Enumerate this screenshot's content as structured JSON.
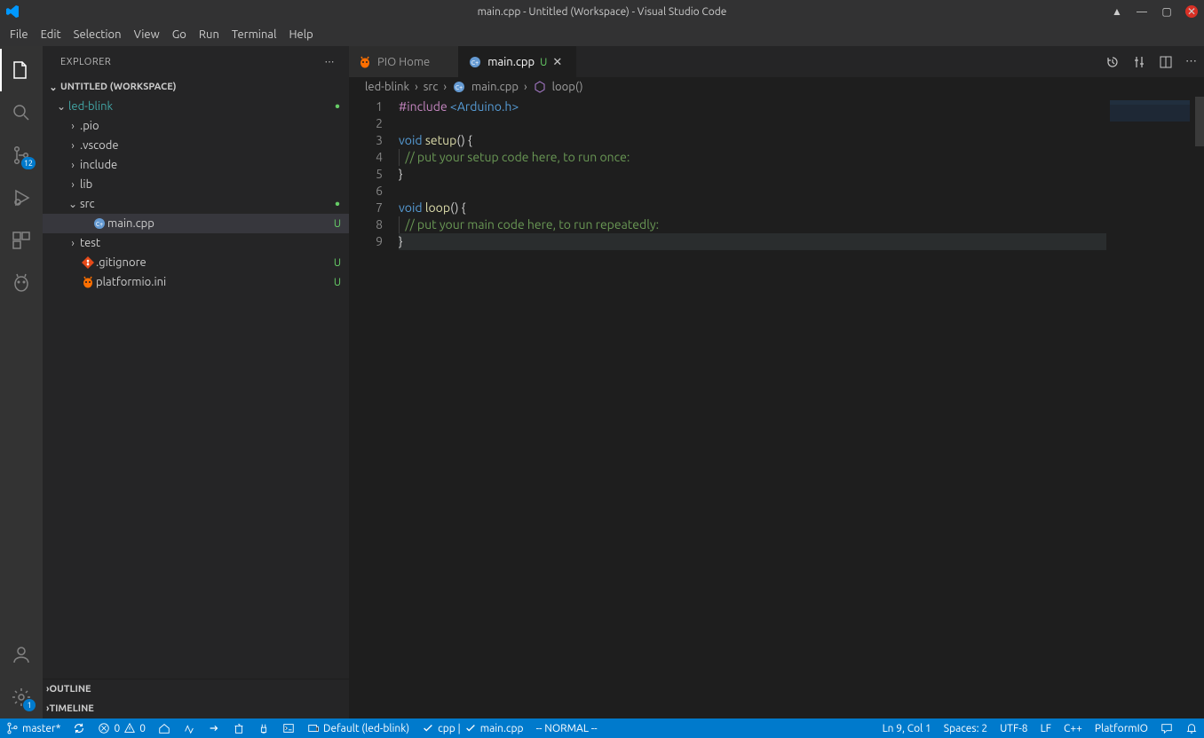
{
  "title": "main.cpp - Untitled (Workspace) - Visual Studio Code",
  "menu": [
    "File",
    "Edit",
    "Selection",
    "View",
    "Go",
    "Run",
    "Terminal",
    "Help"
  ],
  "activity": {
    "scm_badge": "12",
    "settings_badge": "1"
  },
  "sidebar": {
    "header": "EXPLORER",
    "workspace": "UNTITLED (WORKSPACE)",
    "tree": [
      {
        "indent": 0,
        "open": true,
        "type": "folder",
        "name": "led-blink",
        "dot": true,
        "cls": "fldr-led"
      },
      {
        "indent": 1,
        "open": false,
        "type": "folder",
        "name": ".pio"
      },
      {
        "indent": 1,
        "open": false,
        "type": "folder",
        "name": ".vscode"
      },
      {
        "indent": 1,
        "open": false,
        "type": "folder",
        "name": "include"
      },
      {
        "indent": 1,
        "open": false,
        "type": "folder",
        "name": "lib"
      },
      {
        "indent": 1,
        "open": true,
        "type": "folder",
        "name": "src",
        "dot": true
      },
      {
        "indent": 2,
        "type": "file",
        "icon": "cpp",
        "name": "main.cpp",
        "status": "U",
        "active": true
      },
      {
        "indent": 1,
        "open": false,
        "type": "folder",
        "name": "test"
      },
      {
        "indent": 1,
        "type": "file",
        "icon": "git",
        "name": ".gitignore",
        "status": "U"
      },
      {
        "indent": 1,
        "type": "file",
        "icon": "pio",
        "name": "platformio.ini",
        "status": "U"
      }
    ],
    "outline": "OUTLINE",
    "timeline": "TIMELINE"
  },
  "tabs": [
    {
      "icon": "pio",
      "label": "PIO Home",
      "active": false
    },
    {
      "icon": "cpp",
      "label": "main.cpp",
      "status": "U",
      "active": true
    }
  ],
  "breadcrumb": [
    "led-blink",
    "src",
    "main.cpp",
    "loop()"
  ],
  "code": {
    "lines": [
      {
        "n": 1,
        "html": "<span class='tok-pp'>#include</span> <span class='tok-inc'>&lt;Arduino.h&gt;</span>"
      },
      {
        "n": 2,
        "html": ""
      },
      {
        "n": 3,
        "html": "<span class='tok-kw'>void</span> <span class='tok-fn'>setup</span><span class='tok-pn'>() {</span>"
      },
      {
        "n": 4,
        "html": "<span class='guide'></span>  <span class='tok-cm'>// put your setup code here, to run once:</span>"
      },
      {
        "n": 5,
        "html": "<span class='tok-pn'>}</span>"
      },
      {
        "n": 6,
        "html": ""
      },
      {
        "n": 7,
        "html": "<span class='tok-kw'>void</span> <span class='tok-fn'>loop</span><span class='tok-pn'>() {</span>"
      },
      {
        "n": 8,
        "html": "<span class='guide'></span>  <span class='tok-cm'>// put your main code here, to run repeatedly:</span>"
      },
      {
        "n": 9,
        "html": "<span class='tok-pn'>}</span>",
        "cursor": true
      }
    ]
  },
  "status": {
    "branch": "master*",
    "errors": "0",
    "warnings": "0",
    "env": "Default (led-blink)",
    "lang_chk": "cpp |",
    "file_chk": "main.cpp",
    "vim": "-- NORMAL --",
    "cursor": "Ln 9, Col 1",
    "spaces": "Spaces: 2",
    "enc": "UTF-8",
    "eol": "LF",
    "mode": "C++",
    "pio": "PlatformIO"
  }
}
